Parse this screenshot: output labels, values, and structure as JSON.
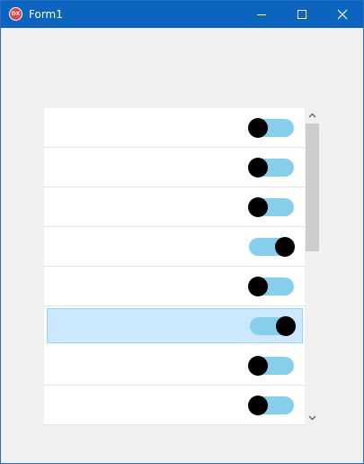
{
  "window": {
    "title": "Form1",
    "icon": "devexpress-logo-icon",
    "icon_text": "DX",
    "accent_color": "#0a64c0"
  },
  "titlebar_controls": {
    "minimize": "minimize-icon",
    "maximize": "maximize-icon",
    "close": "close-icon"
  },
  "list": {
    "items": [
      {
        "toggle": "off",
        "selected": false
      },
      {
        "toggle": "off",
        "selected": false
      },
      {
        "toggle": "off",
        "selected": false
      },
      {
        "toggle": "on",
        "selected": false
      },
      {
        "toggle": "off",
        "selected": false
      },
      {
        "toggle": "on",
        "selected": true
      },
      {
        "toggle": "off",
        "selected": false
      },
      {
        "toggle": "off",
        "selected": false
      }
    ],
    "toggle_track_color": "#87ceeb",
    "toggle_knob_color": "#000000",
    "selected_row_color": "#cce8ff"
  },
  "scrollbar": {
    "up_icon": "chevron-up-icon",
    "down_icon": "chevron-down-icon",
    "position_fraction": 0
  }
}
